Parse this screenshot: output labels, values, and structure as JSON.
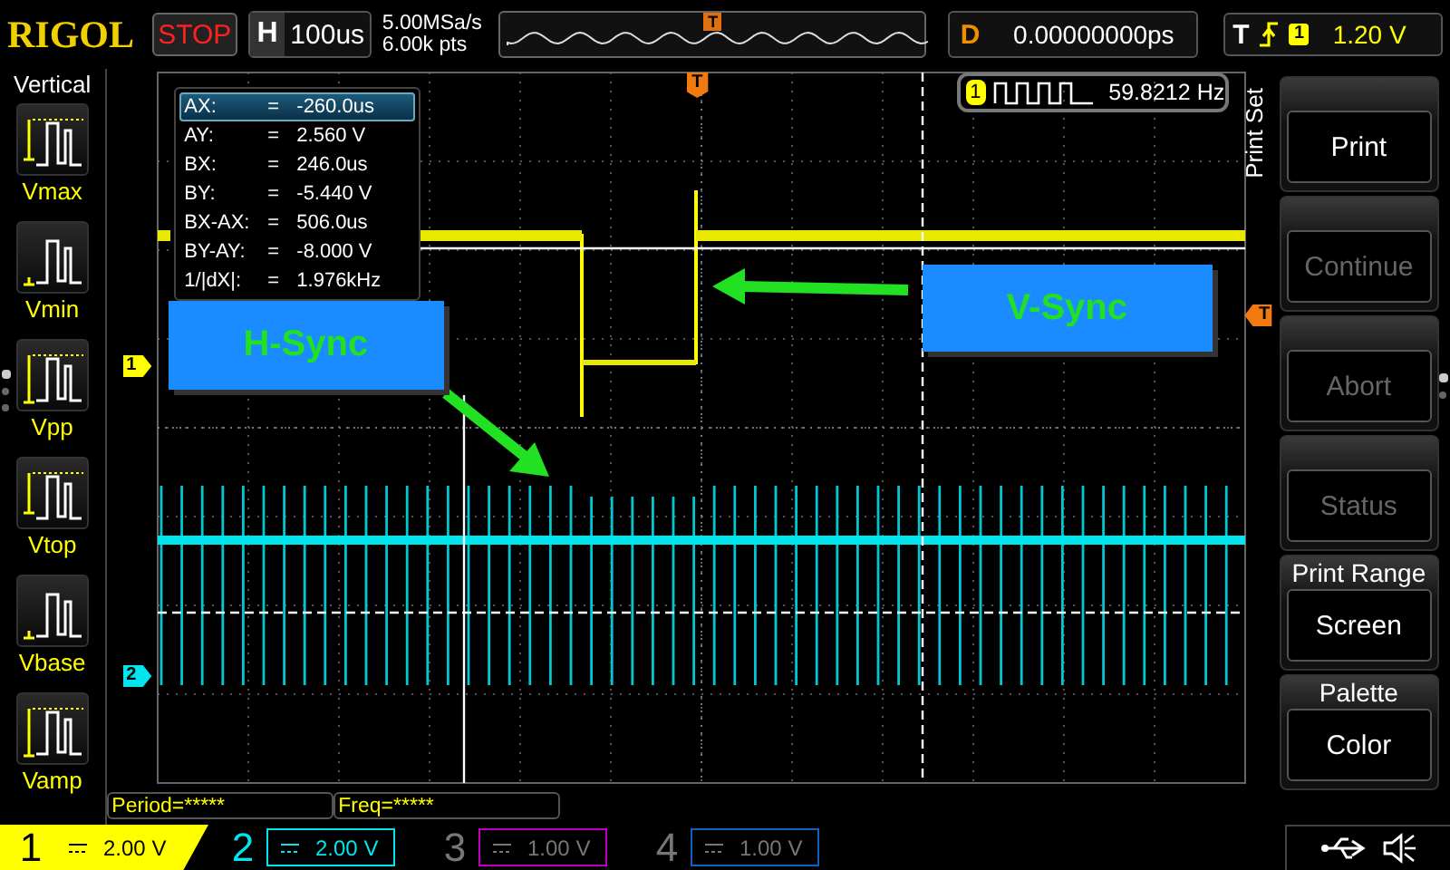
{
  "logo": "RIGOL",
  "run_state": {
    "label": "STOP"
  },
  "timebase": {
    "label": "H",
    "value": "100us"
  },
  "acquisition": {
    "sample_rate": "5.00MSa/s",
    "memory_depth": "6.00k pts"
  },
  "overview": {
    "trigger_marker": "T"
  },
  "delay": {
    "label": "D",
    "value": "0.00000000ps"
  },
  "trigger": {
    "label": "T",
    "channel": "1",
    "level": "1.20 V"
  },
  "sidebar": {
    "title": "Vertical",
    "items": [
      {
        "label": "Vmax",
        "kind": "vmax"
      },
      {
        "label": "Vmin",
        "kind": "vmin"
      },
      {
        "label": "Vpp",
        "kind": "vpp"
      },
      {
        "label": "Vtop",
        "kind": "vtop"
      },
      {
        "label": "Vbase",
        "kind": "vbase"
      },
      {
        "label": "Vamp",
        "kind": "vamp"
      }
    ]
  },
  "cursor_readout": [
    {
      "name": "AX:",
      "sign": "=",
      "value": "-260.0us",
      "selected": true
    },
    {
      "name": "AY:",
      "sign": "=",
      "value": "2.560 V",
      "selected": false
    },
    {
      "name": "BX:",
      "sign": "=",
      "value": "246.0us",
      "selected": false
    },
    {
      "name": "BY:",
      "sign": "=",
      "value": "-5.440 V",
      "selected": false
    },
    {
      "name": "BX-AX:",
      "sign": "=",
      "value": "506.0us",
      "selected": false
    },
    {
      "name": "BY-AY:",
      "sign": "=",
      "value": "-8.000 V",
      "selected": false
    },
    {
      "name": "1/|dX|:",
      "sign": "=",
      "value": "1.976kHz",
      "selected": false
    }
  ],
  "frequency_counter": {
    "channel": "1",
    "value": "59.8212 Hz"
  },
  "trace_markers": [
    {
      "label": "1",
      "color": "#ffff00"
    },
    {
      "label": "2",
      "color": "#00e5ee"
    }
  ],
  "trigger_markers": {
    "position": "T",
    "level": "T"
  },
  "annotations": [
    {
      "text": "H-Sync"
    },
    {
      "text": "V-Sync"
    }
  ],
  "menu": {
    "title": "Print Set",
    "items": [
      {
        "label": "Print",
        "disabled": false
      },
      {
        "label": "Continue",
        "disabled": true
      },
      {
        "label": "Abort",
        "disabled": true
      },
      {
        "label": "Status",
        "disabled": true
      },
      {
        "heading": "Print Range",
        "label": "Screen",
        "disabled": false
      },
      {
        "heading": "Palette",
        "label": "Color",
        "disabled": false
      }
    ]
  },
  "measurements": [
    "Period=*****",
    "Freq=*****"
  ],
  "channels": [
    {
      "number": "1",
      "scale": "2.00 V",
      "on": true,
      "selected": true,
      "color": "#ffff00"
    },
    {
      "number": "2",
      "scale": "2.00 V",
      "on": true,
      "selected": false,
      "color": "#00e5ee"
    },
    {
      "number": "3",
      "scale": "1.00 V",
      "on": false,
      "selected": false,
      "color": "#c000c0"
    },
    {
      "number": "4",
      "scale": "1.00 V",
      "on": false,
      "selected": false,
      "color": "#1060c0"
    }
  ]
}
